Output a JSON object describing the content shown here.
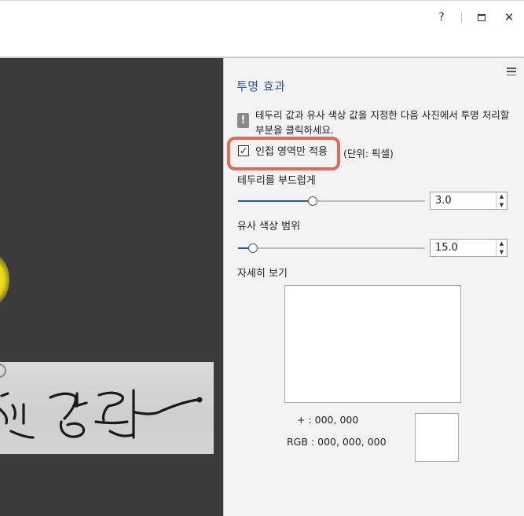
{
  "window": {
    "help_label": "?",
    "close_label": "✕"
  },
  "panel": {
    "title": "투명 효과",
    "info_text": "테두리 값과 유사 색상 값을 지정한 다음 사진에서 투명 처리할 부분을 클릭하세요.",
    "adjacent_only": {
      "label": "인접 영역만 적용",
      "checked": true
    },
    "unit_label": "(단위: 픽셀)",
    "soften_edges": {
      "label": "테두리를 부드럽게",
      "value": "3.0",
      "slider_fraction": 0.4
    },
    "similar_color": {
      "label": "유사 색상 범위",
      "value": "15.0",
      "slider_fraction": 0.08
    },
    "detail_label": "자세히 보기",
    "coords": {
      "label": "+",
      "value": ": 000, 000"
    },
    "rgb": {
      "label": "RGB",
      "value": ": 000, 000, 000"
    }
  },
  "colors": {
    "accent": "#2b579a",
    "highlight": "#e06a5e",
    "workspace": "#3b3b3b",
    "panel_bg": "#f3f3f3"
  }
}
